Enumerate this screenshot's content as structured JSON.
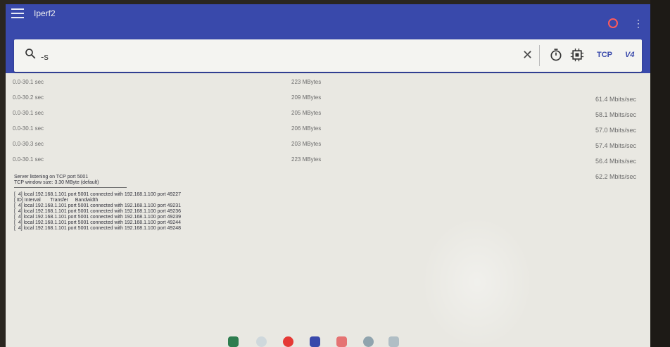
{
  "app": {
    "title": "Iperf2"
  },
  "search": {
    "value": "-s",
    "placeholder": ""
  },
  "toolbar": {
    "protocol": "TCP",
    "ip_version": "V4"
  },
  "results": [
    {
      "interval": "0.0-30.1 sec",
      "transfer": "223 MBytes",
      "bandwidth": ""
    },
    {
      "interval": "0.0-30.2 sec",
      "transfer": "209 MBytes",
      "bandwidth": "61.4 Mbits/sec"
    },
    {
      "interval": "0.0-30.1 sec",
      "transfer": "205 MBytes",
      "bandwidth": "58.1 Mbits/sec"
    },
    {
      "interval": "0.0-30.1 sec",
      "transfer": "206 MBytes",
      "bandwidth": "57.0 Mbits/sec"
    },
    {
      "interval": "0.0-30.3 sec",
      "transfer": "203 MBytes",
      "bandwidth": "57.4 Mbits/sec"
    },
    {
      "interval": "0.0-30.1 sec",
      "transfer": "223 MBytes",
      "bandwidth": "56.4 Mbits/sec"
    },
    {
      "interval": "",
      "transfer": "",
      "bandwidth": "62.2 Mbits/sec"
    }
  ],
  "console": {
    "header": [
      "Server listening on TCP port 5001",
      "TCP window size: 3.30 MByte (default)"
    ],
    "lines": [
      "[  4] local 192.168.1.101 port 5001 connected with 192.168.1.100 port 49227",
      "[ ID] Interval       Transfer     Bandwidth",
      "[  4] local 192.168.1.101 port 5001 connected with 192.168.1.100 port 49231",
      "[  4] local 192.168.1.101 port 5001 connected with 192.168.1.100 port 49236",
      "[  4] local 192.168.1.101 port 5001 connected with 192.168.1.100 port 49239",
      "[  4] local 192.168.1.101 port 5001 connected with 192.168.1.100 port 49244",
      "[  4] local 192.168.1.101 port 5001 connected with 192.168.1.100 port 49248"
    ]
  },
  "colors": {
    "appbar": "#3949ab",
    "accent": "#3949ab",
    "record": "#ff5a5a"
  },
  "icons": [
    "menu-icon",
    "search-icon",
    "close-icon",
    "timer-icon",
    "cpu-icon",
    "record-icon",
    "more-vert-icon"
  ]
}
